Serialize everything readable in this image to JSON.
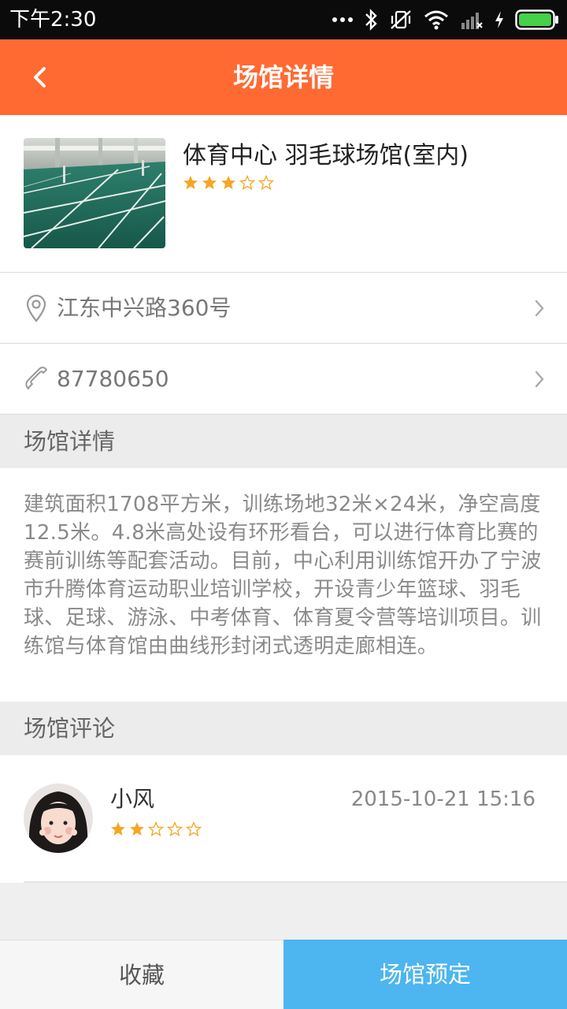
{
  "status_bar": {
    "time": "下午2:30",
    "icons": [
      "more-dots-icon",
      "bluetooth-icon",
      "vibrate-off-icon",
      "wifi-icon",
      "signal-icon",
      "charging-icon",
      "battery-icon"
    ],
    "battery_color": "#45d14a"
  },
  "header": {
    "title": "场馆详情",
    "back_icon": "chevron-left-icon",
    "background": "#ff6a33"
  },
  "venue": {
    "name": "体育中心 羽毛球场馆(室内)",
    "rating": 3,
    "rating_max": 5,
    "address": "江东中兴路360号",
    "phone": "87780650"
  },
  "sections": {
    "details_title": "场馆详情",
    "reviews_title": "场馆评论"
  },
  "description": "建筑面积1708平方米，训练场地32米×24米，净空高度12.5米。4.8米高处设有环形看台，可以进行体育比赛的赛前训练等配套活动。目前，中心利用训练馆开办了宁波市升腾体育运动职业培训学校，开设青少年篮球、羽毛球、足球、游泳、中考体育、体育夏令营等培训项目。训练馆与体育馆由曲线形封闭式透明走廊相连。",
  "reviews": [
    {
      "name": "小风",
      "date": "2015-10-21 15:16",
      "rating": 2,
      "rating_max": 5
    }
  ],
  "bottom_bar": {
    "favorite_label": "收藏",
    "book_label": "场馆预定",
    "book_color": "#4db5f0"
  },
  "colors": {
    "accent": "#ff6a33",
    "star": "#f5a623"
  }
}
